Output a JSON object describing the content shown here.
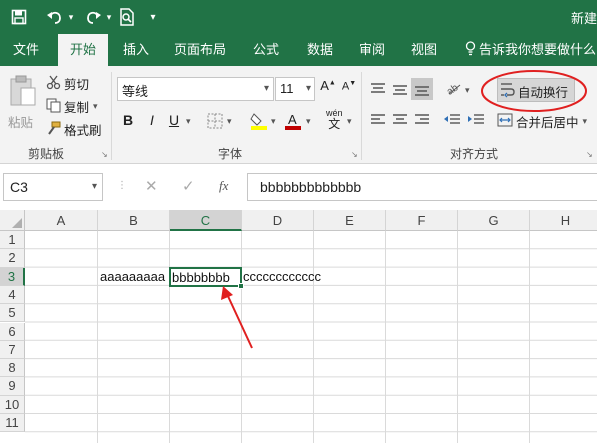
{
  "titlebar": {
    "title": "新建",
    "quick_access": {
      "save_icon": "save-icon",
      "undo_icon": "undo-icon",
      "redo_icon": "redo-icon",
      "print_preview_icon": "print-preview-icon",
      "customize_icon": "customize-icon"
    }
  },
  "tabs": [
    {
      "label": "文件"
    },
    {
      "label": "开始"
    },
    {
      "label": "插入"
    },
    {
      "label": "页面布局"
    },
    {
      "label": "公式"
    },
    {
      "label": "数据"
    },
    {
      "label": "审阅"
    },
    {
      "label": "视图"
    }
  ],
  "tell_me": "告诉我你想要做什么",
  "clipboard": {
    "paste": "粘贴",
    "cut": "剪切",
    "copy": "复制",
    "format_painter": "格式刷",
    "group_label": "剪贴板"
  },
  "font": {
    "name": "等线",
    "size": "11",
    "bold": "B",
    "italic": "I",
    "underline": "U",
    "pinyin": "wén",
    "pinyin_sub": "文",
    "group_label": "字体",
    "fill_color": "#ffff00",
    "font_color": "#c00000"
  },
  "alignment": {
    "wrap_text": "自动换行",
    "merge_center": "合并后居中",
    "group_label": "对齐方式",
    "highlight_color": "#e02020"
  },
  "formula_bar": {
    "name_box": "C3",
    "cancel": "✕",
    "enter": "✓",
    "fx": "fx",
    "content": "bbbbbbbbbbbbb"
  },
  "grid": {
    "columns": [
      "A",
      "B",
      "C",
      "D",
      "E",
      "F",
      "G",
      "H"
    ],
    "selected_column": "C",
    "rows": [
      "1",
      "2",
      "3",
      "4",
      "5",
      "6",
      "7",
      "8",
      "9",
      "10",
      "11"
    ],
    "selected_row": "3",
    "cells": {
      "B3": "aaaaaaaaa",
      "C3": "bbbbbbbb",
      "D3": "cccccccccccc"
    },
    "arrow_color": "#e02020",
    "accent": "#217346"
  }
}
